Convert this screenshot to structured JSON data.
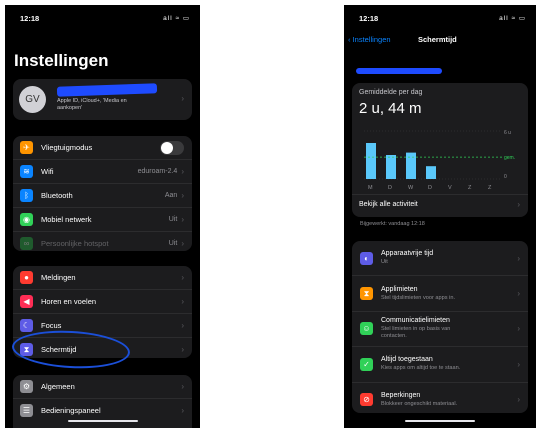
{
  "left": {
    "status": {
      "time": "12:18",
      "icons": "all ≈ ▭"
    },
    "title": "Instellingen",
    "profile": {
      "initials": "GV",
      "subtitle": "Apple ID, iCloud+, 'Media en aankopen'"
    },
    "group1": [
      {
        "label": "Vliegtuigmodus",
        "value": "",
        "icon": "airplane-icon",
        "color": "#ff9500"
      },
      {
        "label": "Wifi",
        "value": "eduroam-2.4",
        "icon": "wifi-icon",
        "color": "#0a84ff"
      },
      {
        "label": "Bluetooth",
        "value": "Aan",
        "icon": "bluetooth-icon",
        "color": "#0a84ff"
      },
      {
        "label": "Mobiel netwerk",
        "value": "Uit",
        "icon": "antenna-icon",
        "color": "#30d158"
      },
      {
        "label": "Persoonlijke hotspot",
        "value": "Uit",
        "icon": "hotspot-icon",
        "color": "#30d158"
      }
    ],
    "group2": [
      {
        "label": "Meldingen",
        "icon": "bell-icon",
        "color": "#ff3b30"
      },
      {
        "label": "Horen en voelen",
        "icon": "speaker-icon",
        "color": "#ff2d55"
      },
      {
        "label": "Focus",
        "icon": "moon-icon",
        "color": "#5e5ce6"
      },
      {
        "label": "Schermtijd",
        "icon": "hourglass-icon",
        "color": "#5e5ce6"
      }
    ],
    "group3": [
      {
        "label": "Algemeen",
        "icon": "gear-icon",
        "color": "#8e8e93"
      },
      {
        "label": "Bedieningspaneel",
        "icon": "switches-icon",
        "color": "#8e8e93"
      }
    ]
  },
  "right": {
    "status": {
      "time": "12:18",
      "icons": "all ≈ ▭"
    },
    "nav": {
      "back": "Instellingen",
      "title": "Schermtijd"
    },
    "chart_card": {
      "label": "Gemiddelde per dag",
      "value": "2 u, 44 m",
      "all": "Bekijk alle activiteit"
    },
    "updated": "Bijgewerkt: vandaag 12:18",
    "chart_data": {
      "type": "bar",
      "categories": [
        "M",
        "D",
        "W",
        "D",
        "V",
        "Z",
        "Z"
      ],
      "values": [
        4.5,
        3.0,
        3.3,
        1.6,
        0,
        0,
        0
      ],
      "avg": 2.73,
      "avg_label": "gem.",
      "ytick_top": "6 u",
      "ytick_bottom": "0",
      "ylim": [
        0,
        6
      ],
      "bar_color": "#5ac8fa",
      "avg_color": "#30d158"
    },
    "options": [
      {
        "title": "Apparaatvrije tijd",
        "sub": "Uit",
        "icon": "downtime-icon",
        "color": "#5e5ce6"
      },
      {
        "title": "Applimieten",
        "sub": "Stel tijdslimieten voor apps in.",
        "icon": "hourglass-icon",
        "color": "#ff9500"
      },
      {
        "title": "Communicatielimieten",
        "sub": "Stel limieten in op basis van contacten.",
        "icon": "person-icon",
        "color": "#30d158"
      },
      {
        "title": "Altijd toegestaan",
        "sub": "Kies apps om altijd toe te staan.",
        "icon": "check-icon",
        "color": "#30d158"
      },
      {
        "title": "Beperkingen",
        "sub": "Blokkeer ongeschikt materiaal.",
        "icon": "block-icon",
        "color": "#ff3b30"
      }
    ]
  }
}
